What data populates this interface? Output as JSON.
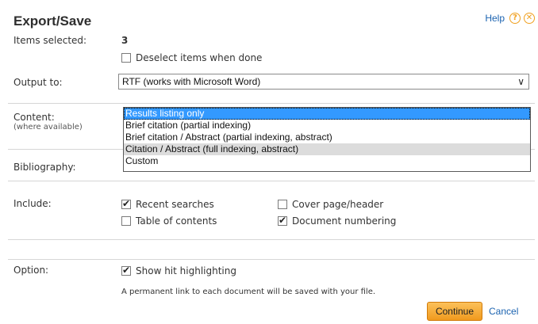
{
  "header": {
    "title": "Export/Save",
    "help_label": "Help",
    "help_icon": "question-circle-icon",
    "close_icon": "close-circle-icon"
  },
  "items_selected": {
    "label": "Items selected:",
    "count": "3",
    "deselect_label": "Deselect items when done",
    "deselect_checked": false
  },
  "output": {
    "label": "Output to:",
    "value": "RTF (works with Microsoft Word)"
  },
  "content": {
    "label": "Content:",
    "sublabel": "(where available)",
    "options": [
      "Results listing only",
      "Brief citation (partial indexing)",
      "Brief citation / Abstract (partial indexing, abstract)",
      "Citation / Abstract (full indexing, abstract)",
      "Custom"
    ],
    "selected_index": 0,
    "hovered_index": 3
  },
  "bibliography": {
    "label": "Bibliography:"
  },
  "include": {
    "label": "Include:",
    "recent_searches": "Recent searches",
    "cover_page": "Cover page/header",
    "table_of_contents": "Table of contents",
    "document_numbering": "Document numbering",
    "checked": {
      "recent_searches": true,
      "cover_page": false,
      "table_of_contents": false,
      "document_numbering": true
    }
  },
  "option": {
    "label": "Option:",
    "hit_highlighting": "Show hit highlighting",
    "hit_highlighting_checked": true,
    "note": "A permanent link to each document will be saved with your file."
  },
  "actions": {
    "continue_label": "Continue",
    "cancel_label": "Cancel"
  },
  "colors": {
    "accent_orange": "#f09a1e",
    "link_blue": "#1a62b0",
    "selection_blue": "#3399ff"
  }
}
